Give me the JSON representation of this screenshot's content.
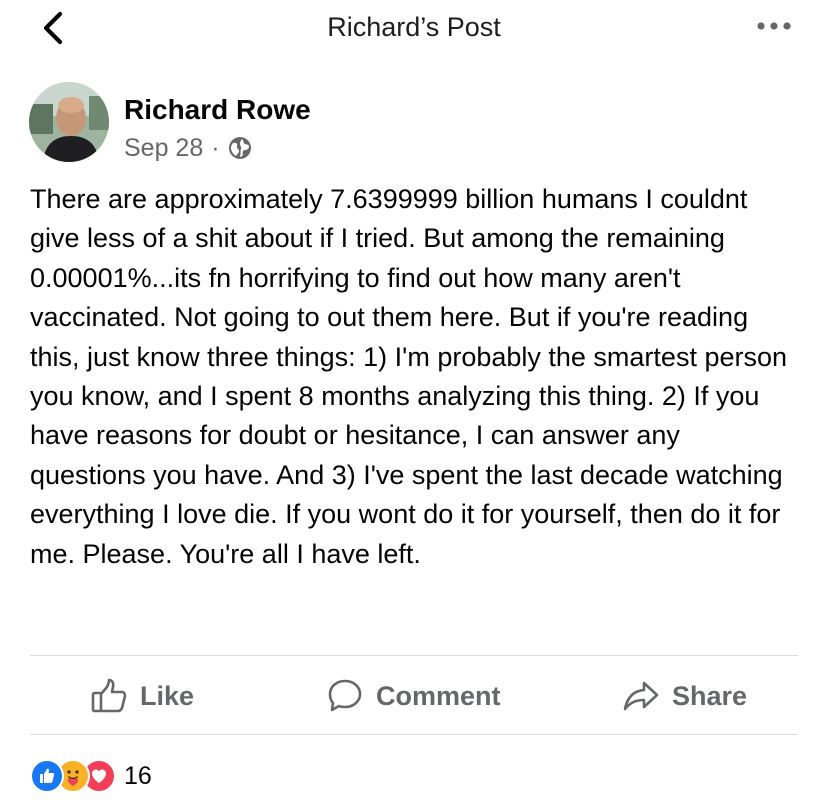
{
  "header": {
    "title": "Richard’s Post",
    "back_icon": "chevron-left-icon",
    "more_icon": "more-horizontal-icon"
  },
  "post": {
    "author": "Richard Rowe",
    "date": "Sep 28",
    "separator": "·",
    "privacy_icon": "globe-icon",
    "text": "There are approximately 7.6399999 billion humans I couldnt give less of a shit about if I tried. But among the remaining 0.00001%...its fn horrifying to find out how many aren't vaccinated. Not going to out them here. But if you're reading this, just know three things: 1) I'm probably the smartest person you know, and I spent 8 months analyzing this thing. 2) If you have reasons for doubt or hesitance, I can answer any questions you have. And 3) I've spent the last decade watching everything I love die. If you wont do it for yourself, then do it for me. Please. You're all I have left."
  },
  "actions": {
    "like": "Like",
    "comment": "Comment",
    "share": "Share"
  },
  "reactions": {
    "types": [
      "like",
      "care",
      "love"
    ],
    "count": "16"
  },
  "colors": {
    "facebook_blue": "#1877f2",
    "love_red": "#f33e58",
    "care_yellow": "#f7b125",
    "muted_text": "#65676b"
  }
}
